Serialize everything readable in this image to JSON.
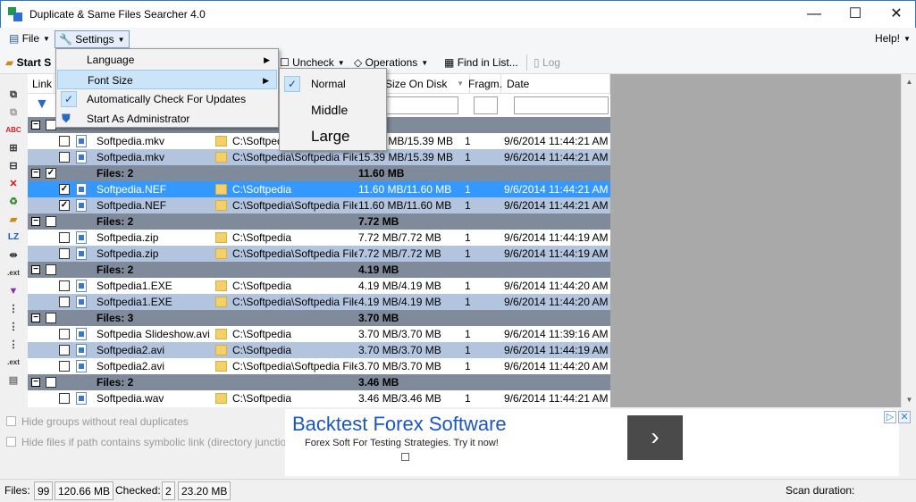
{
  "window": {
    "title": "Duplicate & Same Files Searcher 4.0",
    "minimize": "—",
    "maximize": "☐",
    "close": "✕"
  },
  "menubar": {
    "file": "File",
    "settings": "Settings",
    "help": "Help!"
  },
  "toolbar": {
    "start_search": "Start S",
    "uncheck": "Uncheck",
    "operations": "Operations",
    "find_in_list": "Find in List...",
    "log": "Log"
  },
  "settings_menu": {
    "language": "Language",
    "font_size": "Font Size",
    "auto_check_updates": "Automatically Check For Updates",
    "start_as_admin": "Start As Administrator"
  },
  "font_size_submenu": {
    "normal": "Normal",
    "middle": "Middle",
    "large": "Large",
    "selected": "Normal"
  },
  "grid": {
    "columns": {
      "link": "Link",
      "size_on_disk": "Size On Disk",
      "fragm": "Fragm.",
      "date": "Date"
    },
    "rows": [
      {
        "type": "group",
        "label": "",
        "size": "MB",
        "checked": false
      },
      {
        "type": "file",
        "name": "Softpedia.mkv",
        "path": "C:\\Softpedia",
        "size": "15.39 MB/15.39 MB",
        "fragm": "1",
        "date": "9/6/2014 11:44:21 AM",
        "checked": false,
        "style": "white"
      },
      {
        "type": "file",
        "name": "Softpedia.mkv",
        "path": "C:\\Softpedia\\Softpedia Files",
        "size": "15.39 MB/15.39 MB",
        "fragm": "1",
        "date": "9/6/2014 11:44:21 AM",
        "checked": false,
        "style": "alt"
      },
      {
        "type": "group",
        "label": "Files: 2",
        "size": "11.60 MB",
        "checked": true
      },
      {
        "type": "file",
        "name": "Softpedia.NEF",
        "path": "C:\\Softpedia",
        "size": "11.60 MB/11.60 MB",
        "fragm": "1",
        "date": "9/6/2014 11:44:21 AM",
        "checked": true,
        "style": "sel"
      },
      {
        "type": "file",
        "name": "Softpedia.NEF",
        "path": "C:\\Softpedia\\Softpedia Files",
        "size": "11.60 MB/11.60 MB",
        "fragm": "1",
        "date": "9/6/2014 11:44:21 AM",
        "checked": true,
        "style": "alt"
      },
      {
        "type": "group",
        "label": "Files: 2",
        "size": "7.72 MB",
        "checked": false
      },
      {
        "type": "file",
        "name": "Softpedia.zip",
        "path": "C:\\Softpedia",
        "size": "7.72 MB/7.72 MB",
        "fragm": "1",
        "date": "9/6/2014 11:44:19 AM",
        "checked": false,
        "style": "white"
      },
      {
        "type": "file",
        "name": "Softpedia.zip",
        "path": "C:\\Softpedia\\Softpedia Files",
        "size": "7.72 MB/7.72 MB",
        "fragm": "1",
        "date": "9/6/2014 11:44:19 AM",
        "checked": false,
        "style": "alt"
      },
      {
        "type": "group",
        "label": "Files: 2",
        "size": "4.19 MB",
        "checked": false
      },
      {
        "type": "file",
        "name": "Softpedia1.EXE",
        "path": "C:\\Softpedia",
        "size": "4.19 MB/4.19 MB",
        "fragm": "1",
        "date": "9/6/2014 11:44:20 AM",
        "checked": false,
        "style": "white"
      },
      {
        "type": "file",
        "name": "Softpedia1.EXE",
        "path": "C:\\Softpedia\\Softpedia Files",
        "size": "4.19 MB/4.19 MB",
        "fragm": "1",
        "date": "9/6/2014 11:44:20 AM",
        "checked": false,
        "style": "alt"
      },
      {
        "type": "group",
        "label": "Files: 3",
        "size": "3.70 MB",
        "checked": false
      },
      {
        "type": "file",
        "name": "Softpedia Slideshow.avi",
        "path": "C:\\Softpedia",
        "size": "3.70 MB/3.70 MB",
        "fragm": "1",
        "date": "9/6/2014 11:39:16 AM",
        "checked": false,
        "style": "white"
      },
      {
        "type": "file",
        "name": "Softpedia2.avi",
        "path": "C:\\Softpedia",
        "size": "3.70 MB/3.70 MB",
        "fragm": "1",
        "date": "9/6/2014 11:44:19 AM",
        "checked": false,
        "style": "alt"
      },
      {
        "type": "file",
        "name": "Softpedia2.avi",
        "path": "C:\\Softpedia\\Softpedia Files",
        "size": "3.70 MB/3.70 MB",
        "fragm": "1",
        "date": "9/6/2014 11:44:20 AM",
        "checked": false,
        "style": "white"
      },
      {
        "type": "group",
        "label": "Files: 2",
        "size": "3.46 MB",
        "checked": false
      },
      {
        "type": "file",
        "name": "Softpedia.wav",
        "path": "C:\\Softpedia",
        "size": "3.46 MB/3.46 MB",
        "fragm": "1",
        "date": "9/6/2014 11:44:21 AM",
        "checked": false,
        "style": "white"
      }
    ]
  },
  "options": {
    "hide_groups": "Hide groups without real duplicates",
    "hide_symlink": "Hide files if path contains symbolic link (directory junction)"
  },
  "ad": {
    "title": "Backtest Forex Software",
    "subtitle": "Forex Soft For Testing Strategies. Try it now!",
    "button": "›"
  },
  "status": {
    "files_label": "Files:",
    "files_count": "99",
    "files_size": "120.66 MB",
    "checked_label": "Checked:",
    "checked_count": "2",
    "checked_size": "23.20 MB",
    "scan_duration_label": "Scan duration:"
  },
  "colors": {
    "group_row": "#7f8a9a",
    "alt_row": "#b3c4de",
    "selected_row": "#3399ff",
    "ad_title": "#1a55c7"
  }
}
